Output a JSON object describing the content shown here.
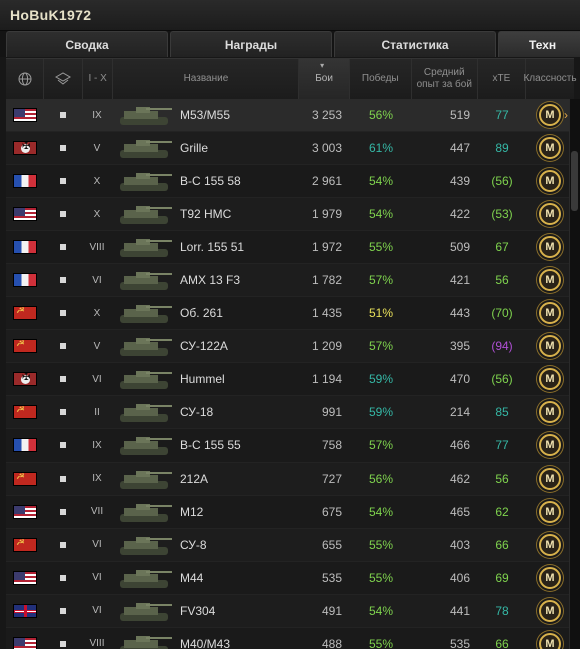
{
  "window": {
    "title": "HoBuK1972"
  },
  "tabs": [
    {
      "label": "Сводка"
    },
    {
      "label": "Награды"
    },
    {
      "label": "Статистика"
    },
    {
      "label": "Техн"
    }
  ],
  "table": {
    "headers": {
      "flag_icon": "globe-icon",
      "type_icon": "vehicle-type-icon",
      "tier": "I - X",
      "name": "Название",
      "battles": "Бои",
      "wins": "Победы",
      "avg_xp": "Средний опыт за бой",
      "xte": "xTE",
      "mastery": "Классность"
    },
    "sorted_by": "battles",
    "rows": [
      {
        "nation": "usa",
        "tier": "IX",
        "name": "M53/M55",
        "battles": "3 253",
        "wins": "56%",
        "wins_color": "#7fd34e",
        "avg_xp": "519",
        "xte": "77",
        "xte_color": "#35b8a6",
        "mastery": "M"
      },
      {
        "nation": "germany",
        "tier": "V",
        "name": "Grille",
        "battles": "3 003",
        "wins": "61%",
        "wins_color": "#35b8a6",
        "avg_xp": "447",
        "xte": "89",
        "xte_color": "#35b8a6",
        "mastery": "M"
      },
      {
        "nation": "france",
        "tier": "X",
        "name": "B-C 155 58",
        "battles": "2 961",
        "wins": "54%",
        "wins_color": "#7fd34e",
        "avg_xp": "439",
        "xte": "(56)",
        "xte_color": "#7fd34e",
        "mastery": "M"
      },
      {
        "nation": "usa",
        "tier": "X",
        "name": "T92 HMC",
        "battles": "1 979",
        "wins": "54%",
        "wins_color": "#7fd34e",
        "avg_xp": "422",
        "xte": "(53)",
        "xte_color": "#7fd34e",
        "mastery": "M"
      },
      {
        "nation": "france",
        "tier": "VIII",
        "name": "Lorr. 155 51",
        "battles": "1 972",
        "wins": "55%",
        "wins_color": "#7fd34e",
        "avg_xp": "509",
        "xte": "67",
        "xte_color": "#7fd34e",
        "mastery": "M"
      },
      {
        "nation": "france",
        "tier": "VI",
        "name": "AMX 13 F3",
        "battles": "1 782",
        "wins": "57%",
        "wins_color": "#7fd34e",
        "avg_xp": "421",
        "xte": "56",
        "xte_color": "#7fd34e",
        "mastery": "M"
      },
      {
        "nation": "ussr",
        "tier": "X",
        "name": "Об. 261",
        "battles": "1 435",
        "wins": "51%",
        "wins_color": "#e8e05a",
        "avg_xp": "443",
        "xte": "(70)",
        "xte_color": "#7fd34e",
        "mastery": "M"
      },
      {
        "nation": "ussr",
        "tier": "V",
        "name": "СУ-122А",
        "battles": "1 209",
        "wins": "57%",
        "wins_color": "#7fd34e",
        "avg_xp": "395",
        "xte": "(94)",
        "xte_color": "#b04fd6",
        "mastery": "M"
      },
      {
        "nation": "germany",
        "tier": "VI",
        "name": "Hummel",
        "battles": "1 194",
        "wins": "59%",
        "wins_color": "#35b8a6",
        "avg_xp": "470",
        "xte": "(56)",
        "xte_color": "#7fd34e",
        "mastery": "M"
      },
      {
        "nation": "ussr",
        "tier": "II",
        "name": "СУ-18",
        "battles": "991",
        "wins": "59%",
        "wins_color": "#35b8a6",
        "avg_xp": "214",
        "xte": "85",
        "xte_color": "#35b8a6",
        "mastery": "M"
      },
      {
        "nation": "france",
        "tier": "IX",
        "name": "B-C 155 55",
        "battles": "758",
        "wins": "57%",
        "wins_color": "#7fd34e",
        "avg_xp": "466",
        "xte": "77",
        "xte_color": "#35b8a6",
        "mastery": "M"
      },
      {
        "nation": "ussr",
        "tier": "IX",
        "name": "212A",
        "battles": "727",
        "wins": "56%",
        "wins_color": "#7fd34e",
        "avg_xp": "462",
        "xte": "56",
        "xte_color": "#7fd34e",
        "mastery": "M"
      },
      {
        "nation": "usa",
        "tier": "VII",
        "name": "M12",
        "battles": "675",
        "wins": "54%",
        "wins_color": "#7fd34e",
        "avg_xp": "465",
        "xte": "62",
        "xte_color": "#7fd34e",
        "mastery": "M"
      },
      {
        "nation": "ussr",
        "tier": "VI",
        "name": "СУ-8",
        "battles": "655",
        "wins": "55%",
        "wins_color": "#7fd34e",
        "avg_xp": "403",
        "xte": "66",
        "xte_color": "#7fd34e",
        "mastery": "M"
      },
      {
        "nation": "usa",
        "tier": "VI",
        "name": "M44",
        "battles": "535",
        "wins": "55%",
        "wins_color": "#7fd34e",
        "avg_xp": "406",
        "xte": "69",
        "xte_color": "#7fd34e",
        "mastery": "M"
      },
      {
        "nation": "uk",
        "tier": "VI",
        "name": "FV304",
        "battles": "491",
        "wins": "54%",
        "wins_color": "#7fd34e",
        "avg_xp": "441",
        "xte": "78",
        "xte_color": "#35b8a6",
        "mastery": "M"
      },
      {
        "nation": "usa",
        "tier": "VIII",
        "name": "M40/M43",
        "battles": "488",
        "wins": "55%",
        "wins_color": "#7fd34e",
        "avg_xp": "535",
        "xte": "66",
        "xte_color": "#7fd34e",
        "mastery": "M"
      }
    ]
  }
}
